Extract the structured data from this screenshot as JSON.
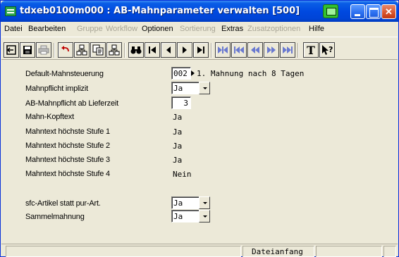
{
  "window": {
    "title": "tdxeb0100m000 : AB-Mahnparameter verwalten [500]",
    "app_icon": "app-icon",
    "controls": {
      "minimize_icon": "minimize-icon",
      "maximize_icon": "maximize-icon",
      "close_icon": "close-icon",
      "close_glyph": "✕"
    }
  },
  "menu": {
    "items": [
      {
        "label": "Datei",
        "enabled": true
      },
      {
        "label": "Bearbeiten",
        "enabled": true
      },
      {
        "label": "Gruppe",
        "enabled": false
      },
      {
        "label": "Workflow",
        "enabled": false
      },
      {
        "label": "Optionen",
        "enabled": true
      },
      {
        "label": "Sortierung",
        "enabled": false
      },
      {
        "label": "Extras",
        "enabled": true
      },
      {
        "label": "Zusatzoptionen",
        "enabled": false
      },
      {
        "label": "Hilfe",
        "enabled": true
      }
    ]
  },
  "toolbar": {
    "tools": [
      "exit-icon",
      "save-icon",
      "print-icon",
      "undo-icon",
      "tree-icon",
      "copy-icon",
      "tree2-icon",
      "binoculars-icon",
      "first-record-icon",
      "previous-record-icon",
      "next-record-icon",
      "last-record-icon",
      "first-group-icon",
      "previous-group-icon",
      "previous-page-icon",
      "next-page-icon",
      "last-group-icon",
      "text-icon",
      "help-pointer-icon"
    ],
    "text_glyph": "T",
    "help_glyph": "?"
  },
  "form": {
    "rows": [
      {
        "label": "Default-Mahnsteuerung",
        "code": "002",
        "description": "1. Mahnung nach 8 Tagen"
      },
      {
        "label": "Mahnpflicht implizit",
        "value": "Ja"
      },
      {
        "label": "AB-Mahnpflicht ab Lieferzeit",
        "value": "3"
      },
      {
        "label": "Mahn-Kopftext",
        "value": "Ja"
      },
      {
        "label": "Mahntext höchste Stufe 1",
        "value": "Ja"
      },
      {
        "label": "Mahntext höchste Stufe 2",
        "value": "Ja"
      },
      {
        "label": "Mahntext höchste Stufe 3",
        "value": "Ja"
      },
      {
        "label": "Mahntext höchste Stufe 4",
        "value": "Nein"
      },
      {
        "label": "sfc-Artikel statt pur-Art.",
        "value": "Ja"
      },
      {
        "label": "Sammelmahnung",
        "value": "Ja"
      }
    ]
  },
  "status": {
    "text": "Dateianfang"
  }
}
